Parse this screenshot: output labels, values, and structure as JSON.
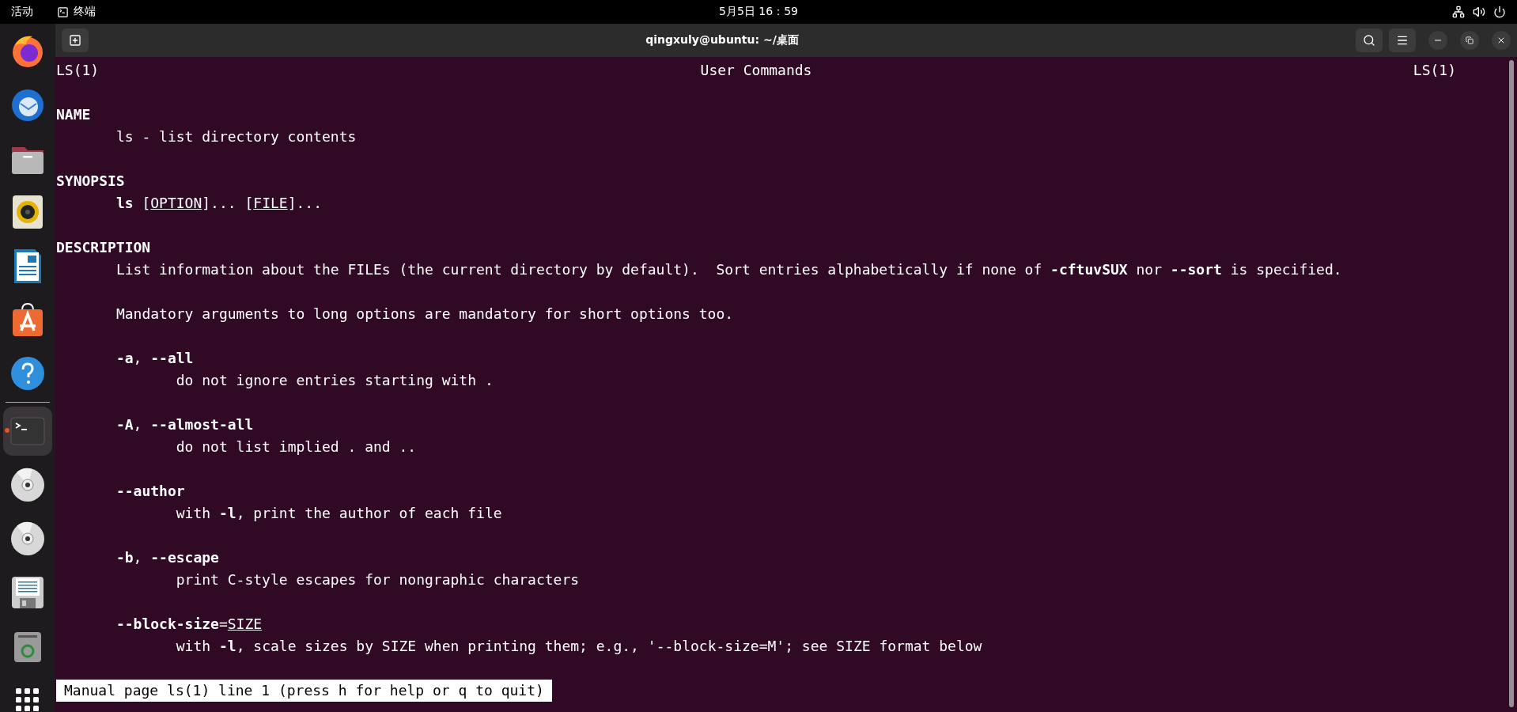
{
  "top_bar": {
    "activities": "活动",
    "app_name": "终端",
    "clock": "5月5日 16：59"
  },
  "dock": {
    "items": [
      {
        "kind": "browser",
        "selected": false,
        "running": false
      },
      {
        "kind": "mail",
        "selected": false,
        "running": false
      },
      {
        "kind": "files",
        "selected": false,
        "running": false
      },
      {
        "kind": "music",
        "selected": false,
        "running": false
      },
      {
        "kind": "writer",
        "selected": false,
        "running": false
      },
      {
        "kind": "store",
        "selected": false,
        "running": false
      },
      {
        "kind": "help",
        "selected": false,
        "running": false
      },
      {
        "kind": "terminal",
        "selected": true,
        "running": true
      },
      {
        "kind": "disc",
        "selected": false,
        "running": false
      },
      {
        "kind": "disc",
        "selected": false,
        "running": false
      },
      {
        "kind": "save",
        "selected": false,
        "running": false
      },
      {
        "kind": "trash",
        "selected": false,
        "running": false
      },
      {
        "kind": "apps",
        "selected": false,
        "running": false
      }
    ]
  },
  "window": {
    "title": "qingxuly@ubuntu: ~/桌面"
  },
  "man_page": {
    "header": {
      "left": "LS(1)",
      "center": "User Commands",
      "right": "LS(1)"
    },
    "lines": [
      {
        "kind": "section",
        "text": "NAME"
      },
      {
        "kind": "para",
        "segments": [
          {
            "text": "ls - list directory contents",
            "kind": "plain"
          }
        ]
      },
      {
        "kind": "section",
        "text": "SYNOPSIS"
      },
      {
        "kind": "para",
        "segments": [
          {
            "text": "ls",
            "kind": "bold"
          },
          {
            "text": " [",
            "kind": "plain"
          },
          {
            "text": "OPTION",
            "kind": "underline"
          },
          {
            "text": "]... [",
            "kind": "plain"
          },
          {
            "text": "FILE",
            "kind": "underline"
          },
          {
            "text": "]...",
            "kind": "plain"
          }
        ]
      },
      {
        "kind": "section",
        "text": "DESCRIPTION"
      },
      {
        "kind": "para",
        "segments": [
          {
            "text": "List information about the FILEs (the current directory by default).  Sort entries alphabetically if none of ",
            "kind": "plain"
          },
          {
            "text": "-cftuvSUX",
            "kind": "bold"
          },
          {
            "text": " nor ",
            "kind": "plain"
          },
          {
            "text": "--sort",
            "kind": "bold"
          },
          {
            "text": " is specified.",
            "kind": "plain"
          }
        ]
      },
      {
        "kind": "para",
        "segments": [
          {
            "text": "Mandatory arguments to long options are mandatory for short options too.",
            "kind": "plain"
          }
        ]
      },
      {
        "kind": "option",
        "segments": [
          {
            "text": "-a",
            "kind": "bold"
          },
          {
            "text": ", ",
            "kind": "plain"
          },
          {
            "text": "--all",
            "kind": "bold"
          }
        ]
      },
      {
        "kind": "desc",
        "segments": [
          {
            "text": "do not ignore entries starting with .",
            "kind": "plain"
          }
        ]
      },
      {
        "kind": "option",
        "segments": [
          {
            "text": "-A",
            "kind": "bold"
          },
          {
            "text": ", ",
            "kind": "plain"
          },
          {
            "text": "--almost-all",
            "kind": "bold"
          }
        ]
      },
      {
        "kind": "desc",
        "segments": [
          {
            "text": "do not list implied . and ..",
            "kind": "plain"
          }
        ]
      },
      {
        "kind": "option",
        "segments": [
          {
            "text": "--author",
            "kind": "bold"
          }
        ]
      },
      {
        "kind": "desc",
        "segments": [
          {
            "text": "with ",
            "kind": "plain"
          },
          {
            "text": "-l",
            "kind": "bold"
          },
          {
            "text": ", print the author of each file",
            "kind": "plain"
          }
        ]
      },
      {
        "kind": "option",
        "segments": [
          {
            "text": "-b",
            "kind": "bold"
          },
          {
            "text": ", ",
            "kind": "plain"
          },
          {
            "text": "--escape",
            "kind": "bold"
          }
        ]
      },
      {
        "kind": "desc",
        "segments": [
          {
            "text": "print C-style escapes for nongraphic characters",
            "kind": "plain"
          }
        ]
      },
      {
        "kind": "option",
        "segments": [
          {
            "text": "--block-size",
            "kind": "bold"
          },
          {
            "text": "=",
            "kind": "plain"
          },
          {
            "text": "SIZE",
            "kind": "underline"
          }
        ]
      },
      {
        "kind": "desc",
        "segments": [
          {
            "text": "with ",
            "kind": "plain"
          },
          {
            "text": "-l",
            "kind": "bold"
          },
          {
            "text": ", scale sizes by SIZE when printing them; e.g., '--block-size=M'; see SIZE format below",
            "kind": "plain"
          }
        ]
      }
    ]
  },
  "status_line": "Manual page ls(1) line 1 (press h for help or q to quit)"
}
